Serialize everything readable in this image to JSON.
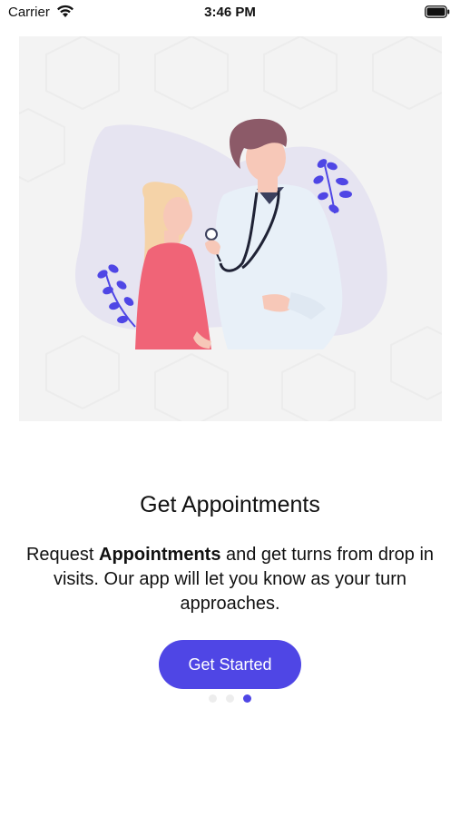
{
  "status_bar": {
    "carrier": "Carrier",
    "time": "3:46 PM",
    "wifi_icon": "wifi-icon",
    "battery_icon": "battery-icon"
  },
  "hero": {
    "illustration": "doctor-patient-illustration"
  },
  "onboarding": {
    "title": "Get Appointments",
    "description_prefix": "Request ",
    "description_bold": "Appointments",
    "description_suffix": " and get turns from drop in visits. Our app will let you know as your turn approaches.",
    "button_label": "Get Started",
    "page_count": 3,
    "current_page": 3
  },
  "colors": {
    "accent": "#4f46e5",
    "blob": "#e6e4f1",
    "patient_shirt": "#f06477",
    "doctor_coat": "#e8f0f8",
    "hair_patient": "#f5d3a8",
    "hair_doctor": "#8c5a68",
    "skin": "#f7c8b8",
    "leaf": "#4f46e5"
  }
}
